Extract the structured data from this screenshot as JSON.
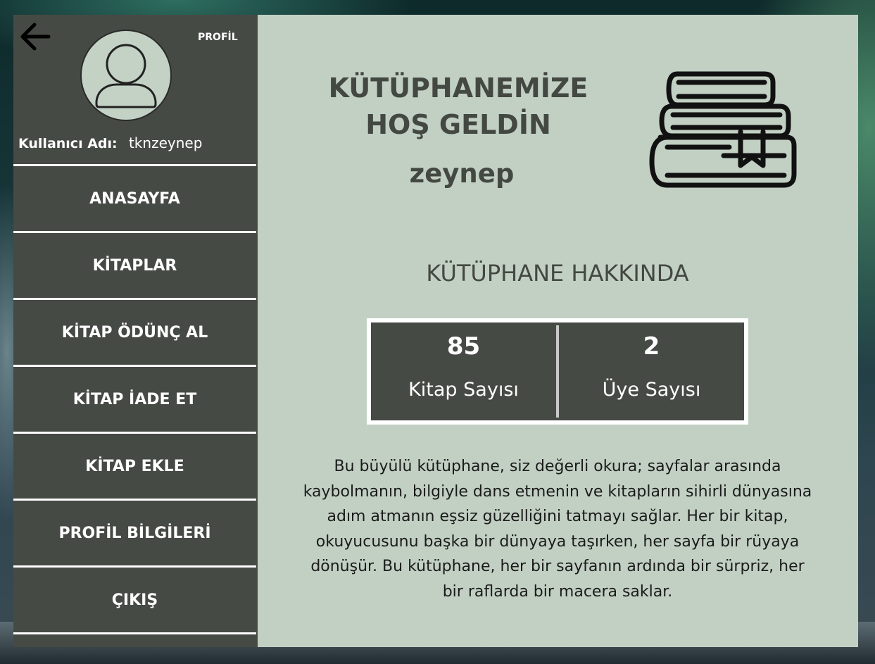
{
  "sidebar": {
    "profile_label": "PROFİL",
    "username_label": "Kullanıcı Adı:",
    "username_value": "tknzeynep",
    "items": [
      {
        "label": "ANASAYFA"
      },
      {
        "label": "KİTAPLAR"
      },
      {
        "label": "KİTAP ÖDÜNÇ AL"
      },
      {
        "label": "KİTAP İADE ET"
      },
      {
        "label": "KİTAP EKLE"
      },
      {
        "label": "PROFİL BİLGİLERİ"
      },
      {
        "label": "ÇIKIŞ"
      }
    ]
  },
  "main": {
    "welcome_line1": "KÜTÜPHANEMİZE",
    "welcome_line2": "HOŞ GELDİN",
    "user_first_name": "zeynep",
    "about_title": "KÜTÜPHANE HAKKINDA",
    "stats": [
      {
        "value": "85",
        "label": "Kitap Sayısı"
      },
      {
        "value": "2",
        "label": "Üye Sayısı"
      }
    ],
    "description_lines": [
      "Bu büyülü kütüphane, siz değerli okura; sayfalar arasında",
      "kaybolmanın, bilgiyle dans etmenin ve kitapların sihirli dünyasına",
      "adım atmanın eşsiz güzelliğini tatmayı sağlar. Her bir kitap,",
      "okuyucusunu başka bir dünyaya taşırken, her sayfa bir rüyaya",
      "dönüşür. Bu kütüphane, her bir sayfanın ardında bir sürpriz, her",
      "bir raflarda bir macera saklar."
    ]
  },
  "icons": {
    "back": "arrow-left-icon",
    "avatar": "user-avatar-icon",
    "books": "books-stack-icon"
  },
  "colors": {
    "sidebar_bg": "#464a44",
    "main_bg": "#c2d0c4",
    "text_dark": "#444842"
  }
}
